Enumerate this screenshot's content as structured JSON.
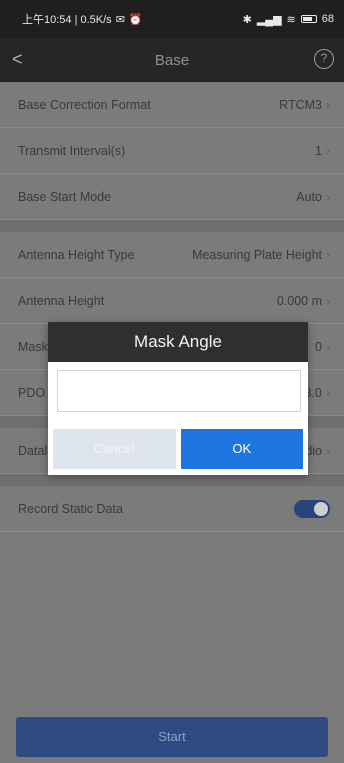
{
  "statusbar": {
    "time_info": "上午10:54 | 0.5K/s",
    "icons_left": [
      "notification-icon",
      "alarm-icon"
    ],
    "icons_right": [
      "bluetooth-icon",
      "signal-icon",
      "wifi-icon",
      "battery-icon"
    ],
    "battery": "68"
  },
  "appbar": {
    "title": "Base",
    "back_glyph": "<",
    "help_glyph": "?"
  },
  "settings": [
    {
      "label": "Base Correction Format",
      "value": "RTCM3"
    },
    {
      "label": "Transmit Interval(s)",
      "value": "1"
    },
    {
      "label": "Base Start Mode",
      "value": "Auto"
    },
    {
      "label": "Antenna Height Type",
      "value": "Measuring Plate Height"
    },
    {
      "label": "Antenna Height",
      "value": "0.000 m"
    },
    {
      "label": "Mask",
      "value": "0"
    },
    {
      "label": "PDO",
      "value": "3.0"
    },
    {
      "label": "Datal",
      "value": "dio"
    },
    {
      "label": "Record Static Data",
      "toggle": true
    }
  ],
  "dialog": {
    "title": "Mask Angle",
    "input_value": "",
    "cancel_label": "Cancel",
    "ok_label": "OK"
  },
  "footer": {
    "start_label": "Start"
  },
  "colors": {
    "accent": "#1f75e0",
    "start_button": "#2e4a80"
  }
}
